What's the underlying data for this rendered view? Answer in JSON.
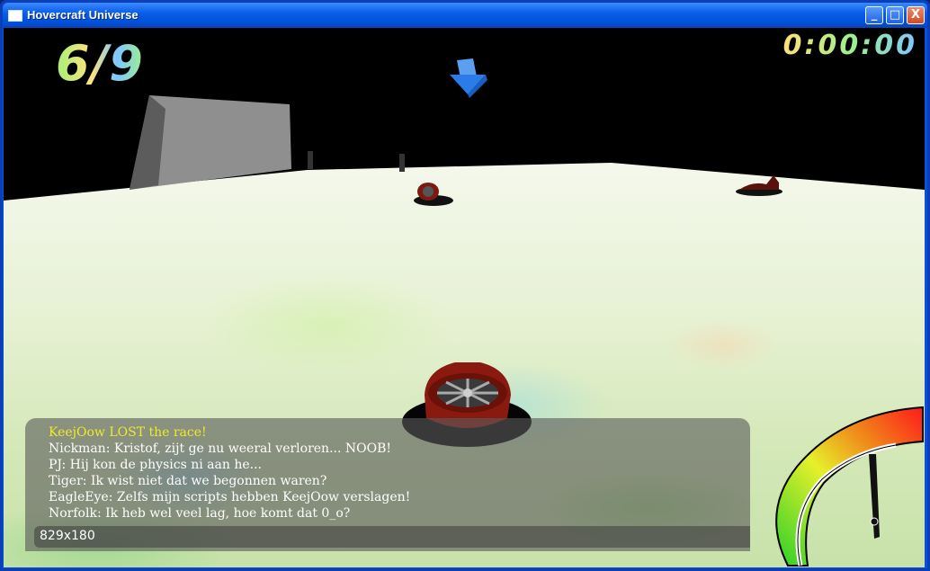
{
  "window": {
    "title": "Hovercraft Universe",
    "min_label": "_",
    "max_label": "□",
    "close_label": "X"
  },
  "hud": {
    "lap": "6/9",
    "timer": "0:00:00"
  },
  "chat": {
    "messages": [
      {
        "text": "KeejOow LOST the race!",
        "kind": "system",
        "color": "#f0ea2a"
      },
      {
        "text": "Nickman: Kristof, zijt ge nu weeral verloren... NOOB!",
        "kind": "player"
      },
      {
        "text": "PJ: Hij kon de physics ni aan he...",
        "kind": "player"
      },
      {
        "text": "Tiger: Ik wist niet dat we begonnen waren?",
        "kind": "player"
      },
      {
        "text": "EagleEye: Zelfs mijn scripts hebben KeejOow verslagen!",
        "kind": "player"
      },
      {
        "text": "Norfolk: Ik heb wel veel lag, hoe komt dat 0_o?",
        "kind": "player"
      }
    ],
    "status": "829x180"
  },
  "icons": {
    "window_icon": "window-icon",
    "checkpoint": "checkpoint-arrow-icon",
    "speedometer": "speedometer-icon"
  },
  "colors": {
    "titlebar": "#0a5ee8",
    "chat_system": "#f0ea2a",
    "hovercraft": "#8a1a10",
    "arrow": "#2a7de8"
  }
}
